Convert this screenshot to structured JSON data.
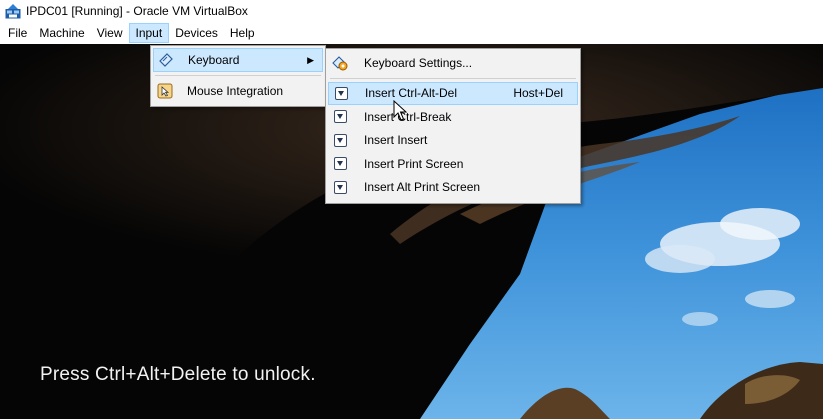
{
  "window": {
    "title": "IPDC01 [Running] - Oracle VM VirtualBox"
  },
  "menubar": {
    "items": [
      {
        "label": "File"
      },
      {
        "label": "Machine"
      },
      {
        "label": "View"
      },
      {
        "label": "Input"
      },
      {
        "label": "Devices"
      },
      {
        "label": "Help"
      }
    ]
  },
  "input_menu": {
    "items": [
      {
        "label": "Keyboard",
        "icon": "keyboard-icon",
        "has_submenu": true
      },
      {
        "label": "Mouse Integration",
        "icon": "mouse-integration-icon"
      }
    ]
  },
  "keyboard_menu": {
    "settings": {
      "label": "Keyboard Settings...",
      "icon": "keyboard-settings-icon"
    },
    "items": [
      {
        "label": "Insert Ctrl-Alt-Del",
        "shortcut": "Host+Del",
        "icon": "insert-icon",
        "highlighted": true
      },
      {
        "label": "Insert Ctrl-Break",
        "icon": "insert-icon"
      },
      {
        "label": "Insert Insert",
        "icon": "insert-icon"
      },
      {
        "label": "Insert Print Screen",
        "icon": "insert-icon"
      },
      {
        "label": "Insert Alt Print Screen",
        "icon": "insert-icon"
      }
    ]
  },
  "guest_screen": {
    "lock_message": "Press Ctrl+Alt+Delete to unlock."
  },
  "colors": {
    "highlight": "#cce8ff",
    "highlight_border": "#99d1ff",
    "menu_bg": "#f2f2f2"
  }
}
